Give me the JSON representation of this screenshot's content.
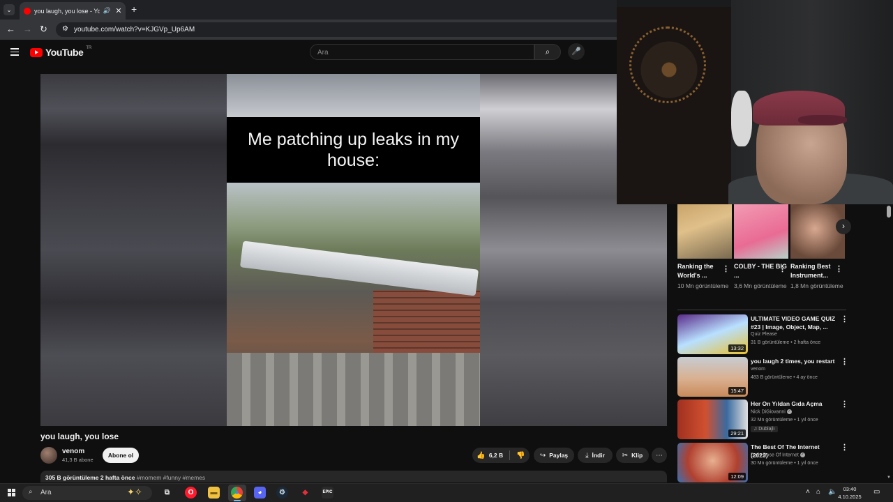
{
  "browser": {
    "tab_title": "you laugh, you lose - YouTube",
    "new_tab_icon": "+",
    "url": "youtube.com/watch?v=KJGVp_Up6AM"
  },
  "youtube": {
    "logo_text": "YouTube",
    "country_code": "TR",
    "search_placeholder": "Ara"
  },
  "video": {
    "caption": "Me patching up leaks in my house:",
    "title": "you laugh, you lose",
    "channel": "venom",
    "subscribers": "41,3 B abone",
    "subscribe_label": "Abone ol",
    "likes": "6,2 B",
    "share_label": "Paylaş",
    "download_label": "İndir",
    "clip_label": "Klip",
    "views": "305 B görüntüleme",
    "age": "2 hafta önce",
    "tags": "#momem #funny #memes"
  },
  "shorts": [
    {
      "title": "Ranking the World's ...",
      "views": "10 Mn görüntüleme"
    },
    {
      "title": "COLBY - THE BIG ...",
      "views": "3,6 Mn görüntüleme"
    },
    {
      "title": "Ranking Best Instrument...",
      "views": "1,8 Mn görüntüleme"
    }
  ],
  "recommendations": [
    {
      "title": "ULTIMATE VIDEO GAME QUIZ #23 | Image, Object, Map, ...",
      "channel": "Quiz Please",
      "meta": "31 B görüntüleme • 2 hafta önce",
      "duration": "13:32",
      "verified": false,
      "badge": ""
    },
    {
      "title": "you laugh 2 times, you restart",
      "channel": "venom",
      "meta": "483 B görüntüleme • 4 ay önce",
      "duration": "15:47",
      "verified": false,
      "badge": ""
    },
    {
      "title": "Her On Yıldan Gıda Açma",
      "channel": "Nick DiGiovanni",
      "meta": "32 Mn görüntüleme • 1 yıl önce",
      "duration": "29:21",
      "verified": true,
      "badge": "Dublajlı"
    },
    {
      "title": "The Best Of The Internet (2023)",
      "channel": "Daily Dose Of Internet",
      "meta": "30 Mn görüntüleme • 1 yıl önce",
      "duration": "12:09",
      "verified": true,
      "badge": ""
    }
  ],
  "taskbar": {
    "search_placeholder": "Ara",
    "time": "03:40",
    "date": "4.10.2025"
  }
}
